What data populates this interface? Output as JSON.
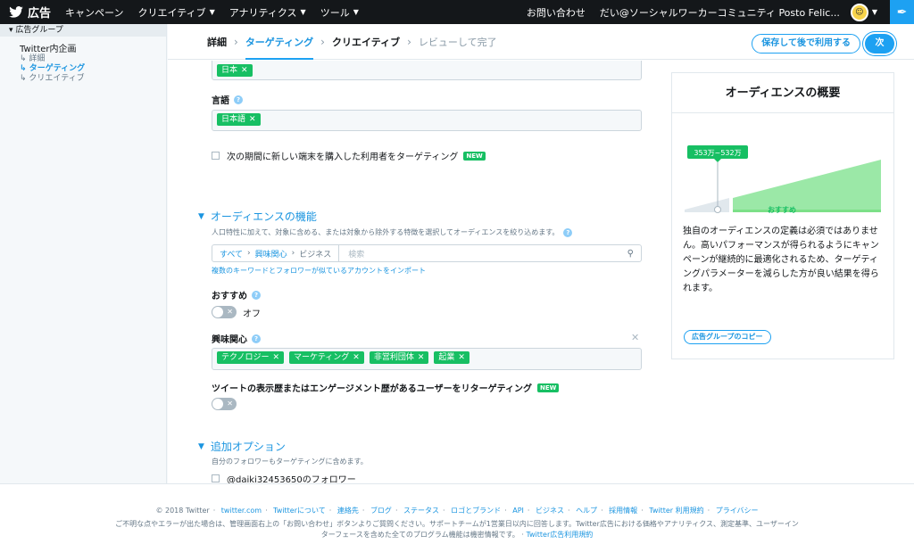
{
  "topnav": {
    "brand": "広告",
    "items": [
      {
        "label": "キャンペーン",
        "chevron": false
      },
      {
        "label": "クリエイティブ",
        "chevron": true
      },
      {
        "label": "アナリティクス",
        "chevron": true
      },
      {
        "label": "ツール",
        "chevron": true
      }
    ],
    "contact": "お問い合わせ",
    "account": "だい@ソーシャルワーカーコミュニティ Posto Felic..."
  },
  "sidebar": {
    "header": "広告グループ",
    "campaign": "Twitter内企画",
    "subs": [
      {
        "label": "詳細",
        "active": false
      },
      {
        "label": "ターゲティング",
        "active": true
      },
      {
        "label": "クリエイティブ",
        "active": false
      }
    ]
  },
  "steps": [
    {
      "label": "詳細",
      "state": "done"
    },
    {
      "label": "ターゲティング",
      "state": "active"
    },
    {
      "label": "クリエイティブ",
      "state": "done"
    },
    {
      "label": "レビューして完了",
      "state": "future"
    }
  ],
  "actions": {
    "save_later": "保存して後で利用する",
    "next": "次"
  },
  "form": {
    "location_tokens": [
      "日本"
    ],
    "language_label": "言語",
    "language_tokens": [
      "日本語"
    ],
    "device_checkbox_label": "次の期間に新しい端末を購入した利用者をターゲティング",
    "new_badge": "NEW",
    "audience_section": "オーディエンスの機能",
    "audience_desc": "人口特性に加えて、対象に含める、または対象から除外する特徴を選択してオーディエンスを絞り込めます。",
    "search": {
      "crumbs": [
        "すべて",
        "興味関心",
        "ビジネス"
      ],
      "placeholder": "検索"
    },
    "import_link": "複数のキーワードとフォロワーが似ているアカウントをインポート",
    "recommend_label": "おすすめ",
    "recommend_state": "オフ",
    "interests_label": "興味関心",
    "interest_tokens": [
      "テクノロジー",
      "マーケティング",
      "非営利団体",
      "起業"
    ],
    "retarget_label": "ツイートの表示歴またはエンゲージメント歴があるユーザーをリターゲティング",
    "extra_section": "追加オプション",
    "extra_desc": "自分のフォロワーもターゲティングに含めます。",
    "followers_checkbox": "@daiki32453650のフォロワー"
  },
  "panel": {
    "title": "オーディエンスの概要",
    "estimate_label": "353万~532万",
    "recommend_caption": "おすすめ",
    "body": "独自のオーディエンスの定義は必須ではありません。高いパフォーマンスが得られるようにキャンペーンが継続的に最適化されるため、ターゲティングパラメーターを減らした方が良い結果を得られます。",
    "copy_button": "広告グループのコピー",
    "colors": {
      "fill": "#9be8a7",
      "bar": "#7ce088",
      "marker": "#17bf63"
    }
  },
  "footer": {
    "links": [
      "© 2018 Twitter",
      "twitter.com",
      "Twitterについて",
      "連絡先",
      "ブログ",
      "ステータス",
      "ロゴとブランド",
      "API",
      "ビジネス",
      "ヘルプ",
      "採用情報",
      "Twitter 利用規約",
      "プライバシー"
    ],
    "notice_1": "ご不明な点やエラーが出た場合は、管理画面右上の「お問い合わせ」ボタンよりご質問ください。サポートチームが1営業日以内に回答します。Twitter広告における価格やアナリティクス、測定基準、ユーザーイン",
    "notice_2": "ターフェースを含めた全てのプログラム機能は機密情報です。",
    "notice_link": "Twitter広告利用規約"
  }
}
